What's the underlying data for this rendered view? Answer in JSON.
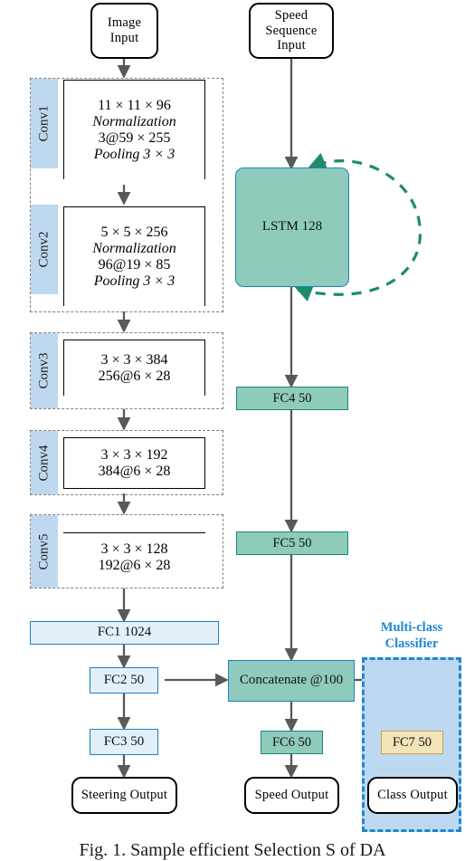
{
  "figure": {
    "caption": "Fig. 1.  Sample efficient Selection S of DA"
  },
  "inputs": {
    "image": {
      "lines": [
        "Image",
        "Input"
      ]
    },
    "speed": {
      "lines": [
        "Speed",
        "Sequence",
        "Input"
      ]
    }
  },
  "conv_stages": [
    {
      "label": "Conv1",
      "lines": [
        {
          "text": "11 × 11 × 96",
          "italic": false
        },
        {
          "text": "Normalization",
          "italic": true
        },
        {
          "text": "3@59 × 255",
          "italic": false
        },
        {
          "text": "Pooling 3 × 3",
          "italic": true
        }
      ]
    },
    {
      "label": "Conv2",
      "lines": [
        {
          "text": "5 × 5 × 256",
          "italic": false
        },
        {
          "text": "Normalization",
          "italic": true
        },
        {
          "text": "96@19 × 85",
          "italic": false
        },
        {
          "text": "Pooling 3 × 3",
          "italic": true
        }
      ]
    },
    {
      "label": "Conv3",
      "lines": [
        {
          "text": "3 × 3 × 384",
          "italic": false
        },
        {
          "text": "256@6 × 28",
          "italic": false
        }
      ]
    },
    {
      "label": "Conv4",
      "lines": [
        {
          "text": "3 × 3 × 192",
          "italic": false
        },
        {
          "text": "384@6 × 28",
          "italic": false
        }
      ]
    },
    {
      "label": "Conv5",
      "lines": [
        {
          "text": "3 × 3 × 128",
          "italic": false
        },
        {
          "text": "192@6 × 28",
          "italic": false
        }
      ]
    }
  ],
  "image_branch": {
    "fc1": "FC1  1024",
    "fc2": "FC2  50",
    "fc3": "FC3 50",
    "output": "Steering Output"
  },
  "speed_branch": {
    "lstm": "LSTM 128",
    "fc4": "FC4 50",
    "fc5": "FC5 50",
    "fc6": "FC6 50",
    "output": "Speed Output"
  },
  "fusion": {
    "concatenate": "Concatenate @100"
  },
  "classifier": {
    "title_lines": [
      "Multi-class",
      "Classifier"
    ],
    "fc7": "FC7 50",
    "output": "Class Output"
  },
  "colors": {
    "conv_tab": "#bed8ef",
    "fc_blue_fill": "#e3eff9",
    "fc_blue_stroke": "#1f7fc0",
    "teal_fill": "#8ecbbd",
    "teal_stroke": "#17867a",
    "yellow_fill": "#f2e3b8",
    "yellow_stroke": "#c9a24a",
    "classifier_fill": "#bdd9f2",
    "classifier_stroke": "#1f86d0",
    "recurrent_arc": "#1f8a6d",
    "arrow": "#595959",
    "group_dash": "#808080"
  }
}
